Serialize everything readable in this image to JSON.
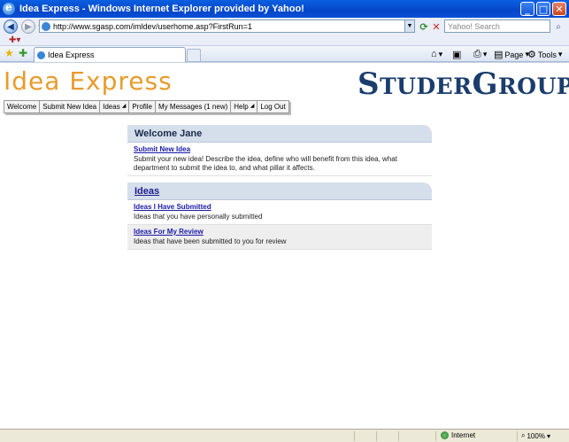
{
  "window": {
    "title": "Idea Express - Windows Internet Explorer provided by Yahoo!",
    "minimize": "_",
    "maximize": "□",
    "close": "✕"
  },
  "addressbar": {
    "url": "http://www.sgasp.com/imldev/userhome.asp?FirstRun=1",
    "search_placeholder": "Yahoo! Search"
  },
  "tab": {
    "label": "Idea Express"
  },
  "commandbar": {
    "page": "Page",
    "tools": "Tools"
  },
  "site": {
    "logo_left": "Idea Express",
    "logo_right": {
      "part1_cap": "S",
      "part1_small": "TUDER",
      "part2_cap": "G",
      "part2_small": "ROUP"
    }
  },
  "menu": {
    "items": [
      {
        "label": "Welcome",
        "arrow": false
      },
      {
        "label": "Submit New Idea",
        "arrow": false
      },
      {
        "label": "Ideas",
        "arrow": true
      },
      {
        "label": "Profile",
        "arrow": false
      },
      {
        "label": "My Messages (1 new)",
        "arrow": false
      },
      {
        "label": "Help",
        "arrow": true
      },
      {
        "label": "Log Out",
        "arrow": false
      }
    ]
  },
  "welcome_panel": {
    "header": "Welcome Jane",
    "rows": [
      {
        "link": "Submit New Idea",
        "desc": "Submit your new idea! Describe the idea, define who will benefit from this idea, what department to submit the idea to, and what pillar it affects."
      }
    ]
  },
  "ideas_panel": {
    "header": "Ideas",
    "rows": [
      {
        "link": "Ideas I Have Submitted",
        "desc": "Ideas that you have personally submitted"
      },
      {
        "link": "Ideas For My Review",
        "desc": "Ideas that have been submitted to you for review"
      }
    ]
  },
  "statusbar": {
    "zone": "Internet",
    "zoom": "100%"
  },
  "colors": {
    "logo_orange": "#e89b2c",
    "logo_navy": "#1a3d6d",
    "panel_header_bg": "#d5dfeb",
    "link_blue": "#1a1aa8"
  }
}
